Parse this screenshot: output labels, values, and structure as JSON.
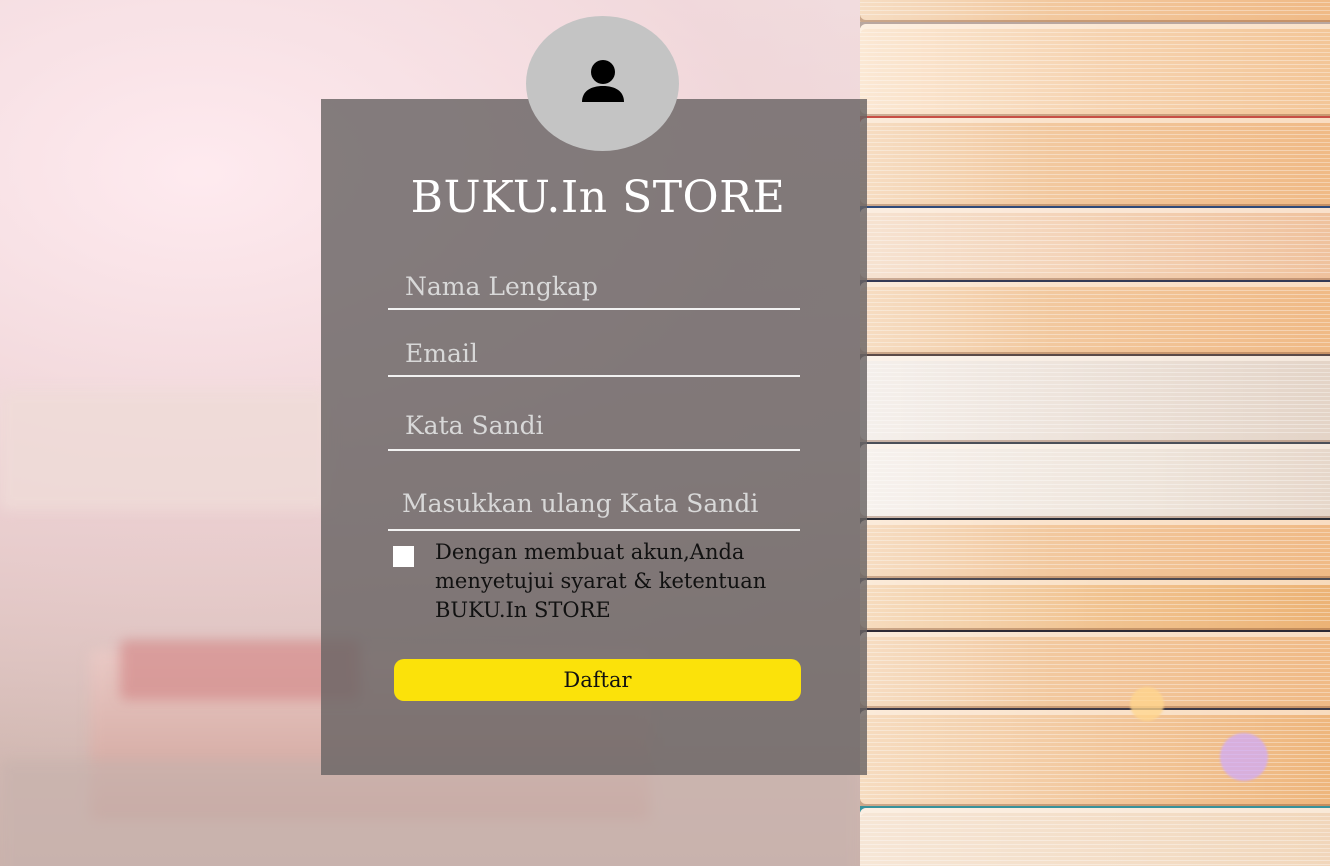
{
  "brand": {
    "title": "BUKU.In STORE"
  },
  "form": {
    "full_name_placeholder": "Nama Lengkap",
    "email_placeholder": "Email",
    "password_placeholder": "Kata Sandi",
    "confirm_password_placeholder": "Masukkan ulang Kata Sandi",
    "terms_text": "Dengan membuat akun,Anda menyetujui syarat & ketentuan BUKU.In STORE",
    "submit_label": "Daftar"
  },
  "colors": {
    "panel": "#6a6464",
    "avatar_bg": "#c4c4c4",
    "button": "#fbe20a",
    "text_light": "#ffffff"
  },
  "icons": {
    "avatar": "user-icon"
  }
}
